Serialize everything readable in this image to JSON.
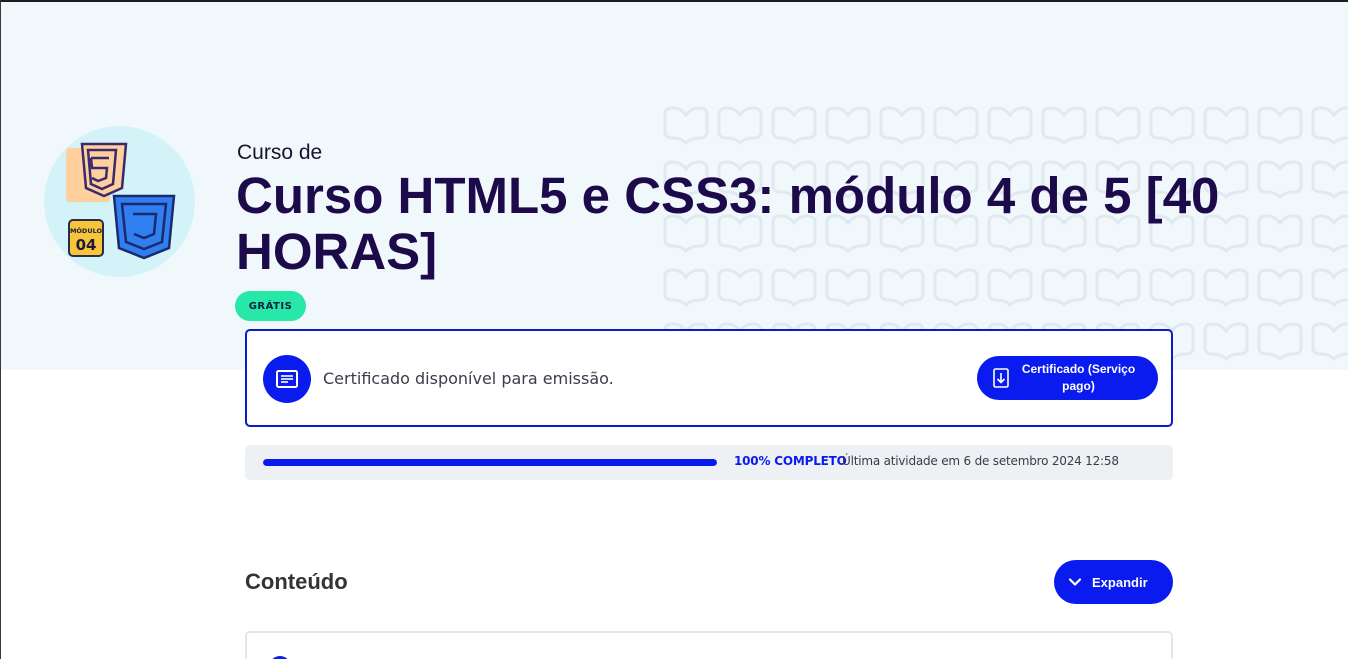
{
  "course": {
    "prefix": "Curso de",
    "title": "Curso HTML5 e CSS3: módulo 4 de 5 [40 HORAS]",
    "badge": "GRÁTIS",
    "logo_badge_top": "MÓDULO",
    "logo_badge_number": "04"
  },
  "certificate": {
    "message": "Certificado disponível para emissão.",
    "button_label": "Certificado (Serviço pago)"
  },
  "progress": {
    "percent": 100,
    "label": "100% COMPLETO",
    "last_activity": "Última atividade em 6 de setembro 2024 12:58"
  },
  "content": {
    "title": "Conteúdo",
    "expand_label": "Expandir"
  },
  "colors": {
    "accent": "#0a1bef",
    "title": "#1c0a4b",
    "badge_bg": "#27e8a9",
    "hero_bg": "#f1f8fb"
  },
  "icons": {
    "certificate": "certificate-icon",
    "download": "download-icon",
    "expand": "chevron-down-icon"
  }
}
